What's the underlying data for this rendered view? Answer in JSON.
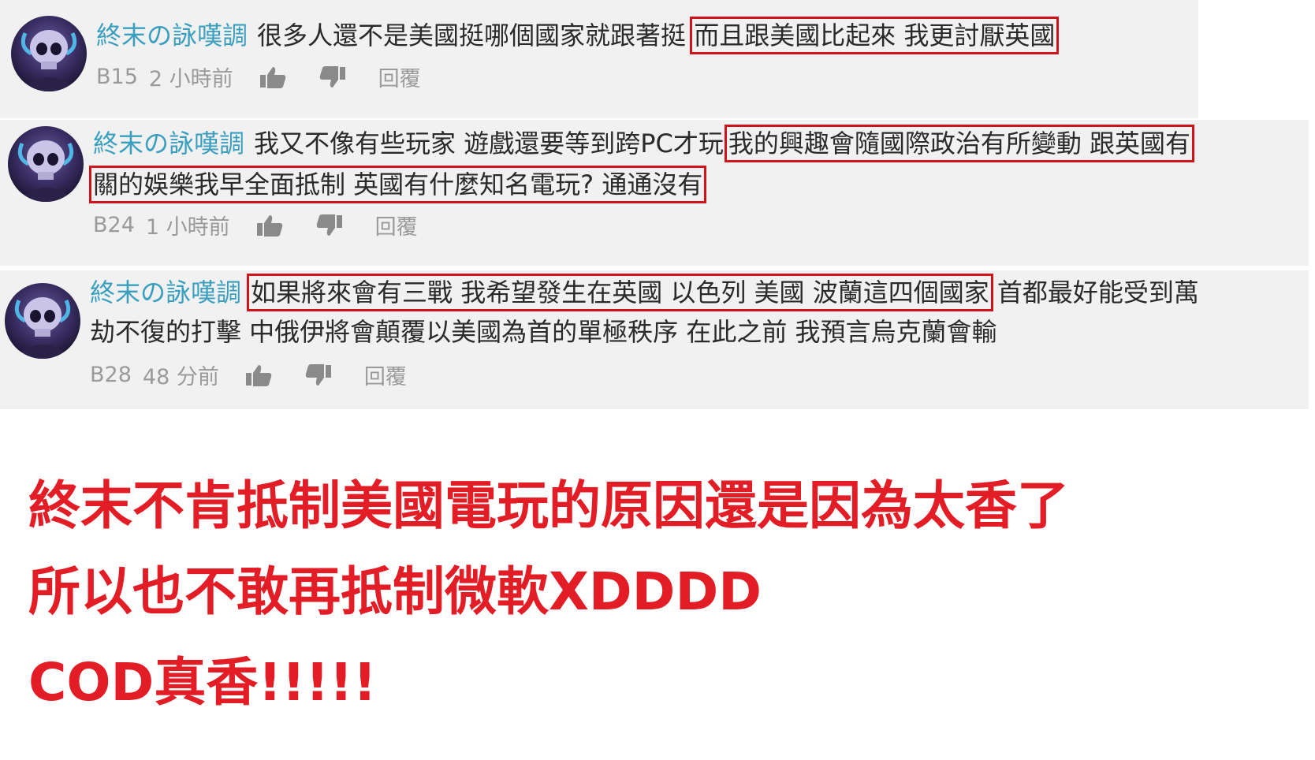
{
  "comments": [
    {
      "user": "終末の詠嘆調",
      "lines": [
        {
          "plain": "很多人還不是美國挺哪個國家就跟著挺",
          "highlight": "而且跟美國比起來 我更討厭英國",
          "after": ""
        }
      ],
      "floor": "B15",
      "time": "2 小時前",
      "reply": "回覆"
    },
    {
      "user": "終末の詠嘆調",
      "lines": [
        {
          "plain": "我又不像有些玩家 遊戲還要等到跨PC才玩",
          "highlight": "我的興趣會隨國際政治有所變動 跟英國有",
          "after": ""
        },
        {
          "plain": "",
          "highlight": "關的娛樂我早全面抵制 英國有什麼知名電玩? 通通沒有",
          "after": ""
        }
      ],
      "floor": "B24",
      "time": "1 小時前",
      "reply": "回覆"
    },
    {
      "user": "終末の詠嘆調",
      "lines": [
        {
          "plain": "",
          "highlight": "如果將來會有三戰 我希望發生在英國 以色列 美國 波蘭這四個國家",
          "after": "首都最好能受到萬"
        },
        {
          "plain": "劫不復的打擊 中俄伊將會顛覆以美國為首的單極秩序 在此之前 我預言烏克蘭會輸",
          "highlight": "",
          "after": ""
        }
      ],
      "floor": "B28",
      "time": "48 分前",
      "reply": "回覆"
    }
  ],
  "caption": {
    "line1": "終末不肯抵制美國電玩的原因還是因為太香了",
    "line2": "所以也不敢再抵制微軟XDDDD",
    "line3": "COD真香!!!!!"
  },
  "colors": {
    "username": "#3a9fbf",
    "highlight_box": "#d0121b",
    "caption": "#e21d26",
    "comment_bg": "#f1f1f1"
  },
  "icons": [
    "thumbs-up-icon",
    "thumbs-down-icon"
  ]
}
